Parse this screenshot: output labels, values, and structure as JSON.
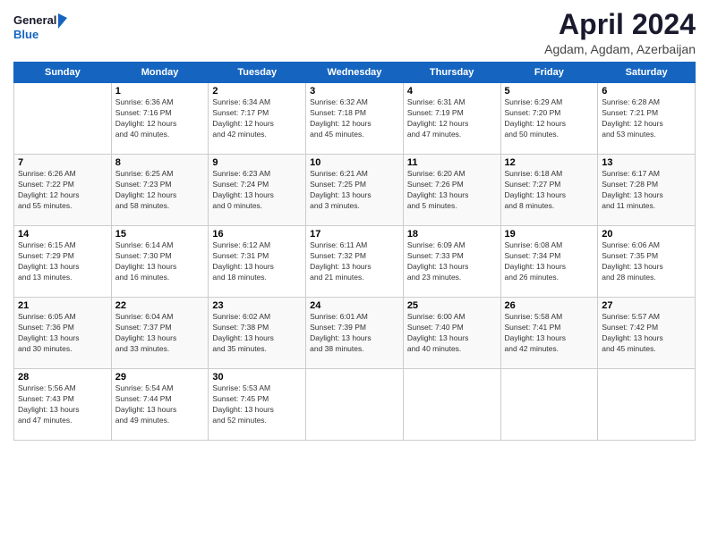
{
  "logo": {
    "line1": "General",
    "line2": "Blue"
  },
  "title": "April 2024",
  "subtitle": "Agdam, Agdam, Azerbaijan",
  "days_of_week": [
    "Sunday",
    "Monday",
    "Tuesday",
    "Wednesday",
    "Thursday",
    "Friday",
    "Saturday"
  ],
  "weeks": [
    [
      {
        "day": "",
        "info": ""
      },
      {
        "day": "1",
        "info": "Sunrise: 6:36 AM\nSunset: 7:16 PM\nDaylight: 12 hours\nand 40 minutes."
      },
      {
        "day": "2",
        "info": "Sunrise: 6:34 AM\nSunset: 7:17 PM\nDaylight: 12 hours\nand 42 minutes."
      },
      {
        "day": "3",
        "info": "Sunrise: 6:32 AM\nSunset: 7:18 PM\nDaylight: 12 hours\nand 45 minutes."
      },
      {
        "day": "4",
        "info": "Sunrise: 6:31 AM\nSunset: 7:19 PM\nDaylight: 12 hours\nand 47 minutes."
      },
      {
        "day": "5",
        "info": "Sunrise: 6:29 AM\nSunset: 7:20 PM\nDaylight: 12 hours\nand 50 minutes."
      },
      {
        "day": "6",
        "info": "Sunrise: 6:28 AM\nSunset: 7:21 PM\nDaylight: 12 hours\nand 53 minutes."
      }
    ],
    [
      {
        "day": "7",
        "info": "Sunrise: 6:26 AM\nSunset: 7:22 PM\nDaylight: 12 hours\nand 55 minutes."
      },
      {
        "day": "8",
        "info": "Sunrise: 6:25 AM\nSunset: 7:23 PM\nDaylight: 12 hours\nand 58 minutes."
      },
      {
        "day": "9",
        "info": "Sunrise: 6:23 AM\nSunset: 7:24 PM\nDaylight: 13 hours\nand 0 minutes."
      },
      {
        "day": "10",
        "info": "Sunrise: 6:21 AM\nSunset: 7:25 PM\nDaylight: 13 hours\nand 3 minutes."
      },
      {
        "day": "11",
        "info": "Sunrise: 6:20 AM\nSunset: 7:26 PM\nDaylight: 13 hours\nand 5 minutes."
      },
      {
        "day": "12",
        "info": "Sunrise: 6:18 AM\nSunset: 7:27 PM\nDaylight: 13 hours\nand 8 minutes."
      },
      {
        "day": "13",
        "info": "Sunrise: 6:17 AM\nSunset: 7:28 PM\nDaylight: 13 hours\nand 11 minutes."
      }
    ],
    [
      {
        "day": "14",
        "info": "Sunrise: 6:15 AM\nSunset: 7:29 PM\nDaylight: 13 hours\nand 13 minutes."
      },
      {
        "day": "15",
        "info": "Sunrise: 6:14 AM\nSunset: 7:30 PM\nDaylight: 13 hours\nand 16 minutes."
      },
      {
        "day": "16",
        "info": "Sunrise: 6:12 AM\nSunset: 7:31 PM\nDaylight: 13 hours\nand 18 minutes."
      },
      {
        "day": "17",
        "info": "Sunrise: 6:11 AM\nSunset: 7:32 PM\nDaylight: 13 hours\nand 21 minutes."
      },
      {
        "day": "18",
        "info": "Sunrise: 6:09 AM\nSunset: 7:33 PM\nDaylight: 13 hours\nand 23 minutes."
      },
      {
        "day": "19",
        "info": "Sunrise: 6:08 AM\nSunset: 7:34 PM\nDaylight: 13 hours\nand 26 minutes."
      },
      {
        "day": "20",
        "info": "Sunrise: 6:06 AM\nSunset: 7:35 PM\nDaylight: 13 hours\nand 28 minutes."
      }
    ],
    [
      {
        "day": "21",
        "info": "Sunrise: 6:05 AM\nSunset: 7:36 PM\nDaylight: 13 hours\nand 30 minutes."
      },
      {
        "day": "22",
        "info": "Sunrise: 6:04 AM\nSunset: 7:37 PM\nDaylight: 13 hours\nand 33 minutes."
      },
      {
        "day": "23",
        "info": "Sunrise: 6:02 AM\nSunset: 7:38 PM\nDaylight: 13 hours\nand 35 minutes."
      },
      {
        "day": "24",
        "info": "Sunrise: 6:01 AM\nSunset: 7:39 PM\nDaylight: 13 hours\nand 38 minutes."
      },
      {
        "day": "25",
        "info": "Sunrise: 6:00 AM\nSunset: 7:40 PM\nDaylight: 13 hours\nand 40 minutes."
      },
      {
        "day": "26",
        "info": "Sunrise: 5:58 AM\nSunset: 7:41 PM\nDaylight: 13 hours\nand 42 minutes."
      },
      {
        "day": "27",
        "info": "Sunrise: 5:57 AM\nSunset: 7:42 PM\nDaylight: 13 hours\nand 45 minutes."
      }
    ],
    [
      {
        "day": "28",
        "info": "Sunrise: 5:56 AM\nSunset: 7:43 PM\nDaylight: 13 hours\nand 47 minutes."
      },
      {
        "day": "29",
        "info": "Sunrise: 5:54 AM\nSunset: 7:44 PM\nDaylight: 13 hours\nand 49 minutes."
      },
      {
        "day": "30",
        "info": "Sunrise: 5:53 AM\nSunset: 7:45 PM\nDaylight: 13 hours\nand 52 minutes."
      },
      {
        "day": "",
        "info": ""
      },
      {
        "day": "",
        "info": ""
      },
      {
        "day": "",
        "info": ""
      },
      {
        "day": "",
        "info": ""
      }
    ]
  ]
}
